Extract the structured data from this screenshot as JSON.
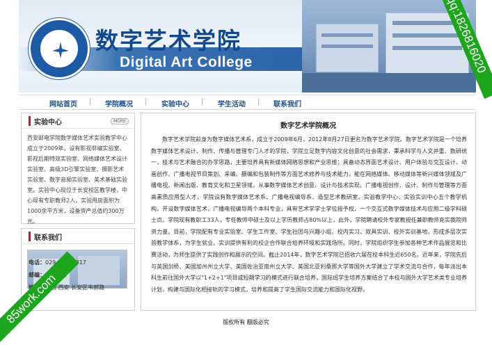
{
  "header": {
    "title_cn": "数字艺术学院",
    "title_en": "Digital Art College",
    "logo_icon": "university-seal-icon",
    "photo": "campus-photo"
  },
  "nav": {
    "items": [
      "网站首页",
      "学院概况",
      "实验中心",
      "学生活动",
      "联系我们"
    ]
  },
  "sidebar": {
    "lab_center": {
      "title": "实验中心",
      "more": "MORE",
      "text": "西安邮电学院数字媒体艺术实验教学中心成立于2009年，设有影视非编实验室、影视后期特效实验室、网络媒体艺术设计实验室、高级3D引擎实验室、摄影艺术实验室、数字音频实验室、美术基础实验室。实验中心现位于长安校区教学楼，中心现有专职教师2人，实验用房面积为1000余平方米，设备资产总值约300万元。"
    },
    "contact": {
      "title": "联系我们",
      "phone_label": "电话：",
      "phone": "029-88166317",
      "postcode_label": "邮编：",
      "postcode": "710061",
      "address_label": "地址：",
      "address": "中国 西安 长安区韦郭路"
    }
  },
  "main": {
    "title": "数字艺术学院概况",
    "body": "数字艺术学院前身为数字媒体艺术系，成立于2009年6月，2012年8月27日更名为数字艺术学院。数字艺术学院是一个培养数字媒体艺术设计、制作、传播与管理专门人才的学院，学院立足数字内容文化创意的社会需求，秉承科学与人文并重、数研统一，技术与艺术融合的办学思路，主要培养具有新媒体网络思想和产业思维；具备动态界面艺术设计、用户体验与交互设计、动画创作、广播电视节目策划、采编、摄编和包装制作等方面艺术修养与技术能力，能在网络媒体、移动媒体等新兴媒体领域及广播电视、新闻出版、教育文化和卫星领域，从事数字媒体艺术创意、设计与技术实现、广播电视创作、设计、制作与管理等方面高素质应用型人才。学院设有数字媒体艺术系、广播电视编导系、造型艺术教研室、实验教学中心、实验实训中心五个教学机构。开设数字媒体艺术、广播电视编导两个本科专业，具有艺术学学士学位授予权，一个交互式数字媒体技术与应用二级学科硕士点。学院现有教职工33人，专任教师中硕士及以上学历教师占80%以上，此外，学院聘请校外专家教授任兼职教师充实我院师资力量。目前，学院配有专业实验室、学生工作室、学生社团与兴趣小组、校内实习、双具实训、校外实训基地，形成多层次实验教学体系，为学生就业、实训提供有利的校企合作联合培养环境和实践场所。同时，学院组织学生参加各种艺术作品展览和比赛活动，为师生提供了实践创作和展示的空间。截止2014年，数字艺术学院已招收六届在校本科生近650名。近年来，学院先后与英国剑桥、美国加州州立大学、美国佐治亚南州立大学、美国北亚利桑那大学等国外大学建立了学术交流与合作，每年派出本科生前往国外大学以\"1+2+1\"项目或短期学习的模式进行联合培养，国际班学生培养方案结合了本校与国外大学艺术类专业培养计划，构建与国际化相接轨的学习模式，培养和提高了学生国际交流能力和国际化视野。"
  },
  "footer": {
    "text": "版权所有 翻版必究"
  },
  "watermarks": {
    "top_right": "qq:1826816020",
    "bottom_left": "85work.com"
  },
  "colors": {
    "brand_blue": "#12498e",
    "accent_red": "#c9171e",
    "ribbon_green": "#1ea51e"
  }
}
